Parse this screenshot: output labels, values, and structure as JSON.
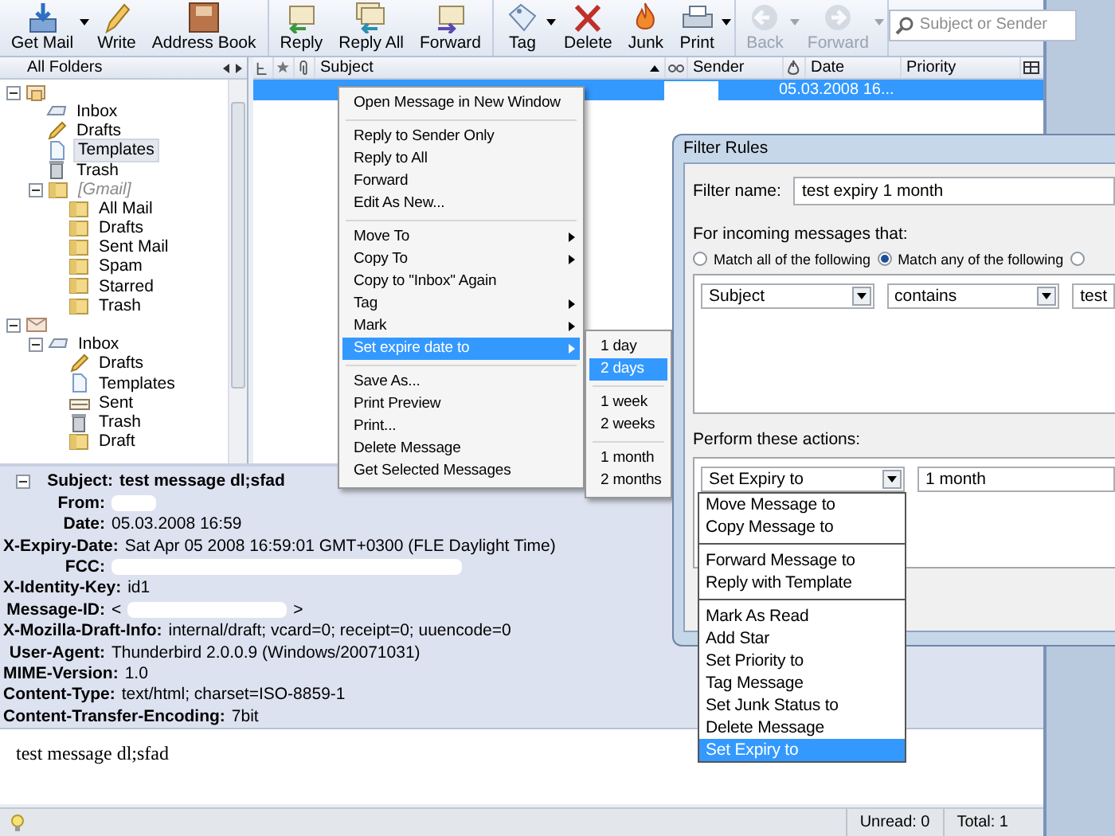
{
  "toolbar": {
    "groups": [
      [
        {
          "kind": "getmail",
          "label": "Get Mail",
          "dropdown": true,
          "disabled": false
        },
        {
          "kind": "write",
          "label": "Write",
          "dropdown": false,
          "disabled": false
        },
        {
          "kind": "addressbook",
          "label": "Address Book",
          "dropdown": false,
          "disabled": false
        }
      ],
      [
        {
          "kind": "reply",
          "label": "Reply",
          "dropdown": false,
          "disabled": false
        },
        {
          "kind": "replyall",
          "label": "Reply All",
          "dropdown": false,
          "disabled": false
        },
        {
          "kind": "forward",
          "label": "Forward",
          "dropdown": false,
          "disabled": false
        }
      ],
      [
        {
          "kind": "tag",
          "label": "Tag",
          "dropdown": true,
          "disabled": false
        },
        {
          "kind": "delete",
          "label": "Delete",
          "dropdown": false,
          "disabled": false
        },
        {
          "kind": "junk",
          "label": "Junk",
          "dropdown": false,
          "disabled": false
        },
        {
          "kind": "print",
          "label": "Print",
          "dropdown": true,
          "disabled": false
        }
      ],
      [
        {
          "kind": "back",
          "label": "Back",
          "dropdown": true,
          "disabled": true
        },
        {
          "kind": "next",
          "label": "Forward",
          "dropdown": true,
          "disabled": true
        }
      ]
    ],
    "search": {
      "placeholder": "Subject or Sender"
    }
  },
  "folder_pane": {
    "title": "All Folders",
    "folders": [
      {
        "kind": "account",
        "expanded": true,
        "children": [
          {
            "kind": "inbox",
            "label": "Inbox",
            "selected": false
          },
          {
            "kind": "drafts",
            "label": "Drafts",
            "selected": false
          },
          {
            "kind": "templates",
            "label": "Templates",
            "selected": true
          },
          {
            "kind": "trash",
            "label": "Trash",
            "selected": false
          },
          {
            "kind": "folder",
            "label": "[Gmail]",
            "virtual": true,
            "selected": false,
            "expanded": true,
            "children": [
              {
                "kind": "folder",
                "label": "All Mail",
                "selected": false
              },
              {
                "kind": "folder",
                "label": "Drafts",
                "selected": false
              },
              {
                "kind": "folder",
                "label": "Sent Mail",
                "selected": false
              },
              {
                "kind": "folder",
                "label": "Spam",
                "selected": false
              },
              {
                "kind": "folder",
                "label": "Starred",
                "selected": false
              },
              {
                "kind": "folder",
                "label": "Trash",
                "selected": false
              }
            ]
          }
        ]
      },
      {
        "kind": "localaccount",
        "expanded": true,
        "children": [
          {
            "kind": "inbox",
            "label": "Inbox",
            "selected": false,
            "expanded": true,
            "children": [
              {
                "kind": "drafts",
                "label": "Drafts",
                "selected": false
              },
              {
                "kind": "templates",
                "label": "Templates",
                "selected": false
              },
              {
                "kind": "sent",
                "label": "Sent",
                "selected": false
              },
              {
                "kind": "trash",
                "label": "Trash",
                "selected": false
              },
              {
                "kind": "folder",
                "label": "Draft",
                "selected": false
              }
            ]
          }
        ]
      }
    ]
  },
  "thread_pane": {
    "columns": [
      {
        "kind": "thread"
      },
      {
        "kind": "star"
      },
      {
        "kind": "attachment"
      },
      {
        "kind": "text",
        "label": "Subject",
        "sorted": true
      },
      {
        "kind": "read"
      },
      {
        "kind": "text",
        "label": "Sender"
      },
      {
        "kind": "junk"
      },
      {
        "kind": "text",
        "label": "Date"
      },
      {
        "kind": "text",
        "label": "Priority"
      },
      {
        "kind": "picker"
      }
    ],
    "rows": [
      {
        "date": "05.03.2008 16...",
        "selected": true
      }
    ]
  },
  "context_menu": {
    "groups": [
      [
        {
          "label": "Open Message in New Window",
          "submenu": false,
          "selected": false
        }
      ],
      [
        {
          "label": "Reply to Sender Only",
          "submenu": false,
          "selected": false
        },
        {
          "label": "Reply to All",
          "submenu": false,
          "selected": false
        },
        {
          "label": "Forward",
          "submenu": false,
          "selected": false
        },
        {
          "label": "Edit As New...",
          "submenu": false,
          "selected": false
        }
      ],
      [
        {
          "label": "Move To",
          "submenu": true,
          "selected": false
        },
        {
          "label": "Copy To",
          "submenu": true,
          "selected": false
        },
        {
          "label": "Copy to \"Inbox\" Again",
          "submenu": false,
          "selected": false
        },
        {
          "label": "Tag",
          "submenu": true,
          "selected": false
        },
        {
          "label": "Mark",
          "submenu": true,
          "selected": false
        },
        {
          "label": "Set expire date to",
          "submenu": true,
          "selected": true
        }
      ],
      [
        {
          "label": "Save As...",
          "submenu": false,
          "selected": false
        },
        {
          "label": "Print Preview",
          "submenu": false,
          "selected": false
        },
        {
          "label": "Print...",
          "submenu": false,
          "selected": false
        },
        {
          "label": "Delete Message",
          "submenu": false,
          "selected": false
        },
        {
          "label": "Get Selected Messages",
          "submenu": false,
          "selected": false
        }
      ]
    ]
  },
  "submenu": {
    "groups": [
      [
        {
          "label": "1 day",
          "selected": false
        },
        {
          "label": "2 days",
          "selected": true
        }
      ],
      [
        {
          "label": "1 week",
          "selected": false
        },
        {
          "label": "2 weeks",
          "selected": false
        }
      ],
      [
        {
          "label": "1 month",
          "selected": false
        },
        {
          "label": "2 months",
          "selected": false
        }
      ]
    ]
  },
  "message_headers": {
    "expanded": true,
    "fields": [
      {
        "label": "Subject:",
        "value": "test message dl;sfad",
        "bold": true
      },
      {
        "label": "From:",
        "redacted": true
      },
      {
        "label": "Date:",
        "value": "05.03.2008 16:59"
      },
      {
        "label": "X-Expiry-Date:",
        "value": "Sat Apr 05 2008 16:59:01 GMT+0300 (FLE Daylight Time)"
      },
      {
        "label": "FCC:",
        "redacted": true
      },
      {
        "label": "X-Identity-Key:",
        "value": "id1"
      },
      {
        "label": "Message-ID:",
        "value": "<",
        "value_after": ">",
        "redacted": true
      },
      {
        "label": "X-Mozilla-Draft-Info:",
        "value": "internal/draft; vcard=0; receipt=0; uuencode=0"
      },
      {
        "label": "User-Agent:",
        "value": "Thunderbird 2.0.0.9 (Windows/20071031)"
      },
      {
        "label": "MIME-Version:",
        "value": "1.0"
      },
      {
        "label": "Content-Type:",
        "value": "text/html; charset=ISO-8859-1"
      },
      {
        "label": "Content-Transfer-Encoding:",
        "value": "7bit"
      }
    ]
  },
  "message_body": "test message dl;sfad",
  "status_bar": {
    "unread": "Unread: 0",
    "total": "Total: 1"
  },
  "filter_dialog": {
    "title": "Filter Rules",
    "name_label": "Filter name:",
    "name_value": "test expiry 1 month",
    "conditions_label": "For incoming messages that:",
    "match_options": [
      {
        "label": "Match all of the following",
        "selected": false
      },
      {
        "label": "Match any of the following",
        "selected": true
      },
      {
        "selected": false
      }
    ],
    "condition": {
      "field": "Subject",
      "operator": "contains",
      "value": "test"
    },
    "actions_label": "Perform these actions:",
    "action": {
      "type": "Set Expiry to",
      "value": "1 month"
    },
    "action_dropdown": {
      "groups": [
        [
          {
            "label": "Move Message to",
            "selected": false
          },
          {
            "label": "Copy Message to",
            "selected": false
          }
        ],
        [
          {
            "label": "Forward Message to",
            "selected": false
          },
          {
            "label": "Reply with Template",
            "selected": false
          }
        ],
        [
          {
            "label": "Mark As Read",
            "selected": false
          },
          {
            "label": "Add Star",
            "selected": false
          },
          {
            "label": "Set Priority to",
            "selected": false
          },
          {
            "label": "Tag Message",
            "selected": false
          },
          {
            "label": "Set Junk Status to",
            "selected": false
          },
          {
            "label": "Delete Message",
            "selected": false
          },
          {
            "label": "Set Expiry to",
            "selected": true
          }
        ]
      ]
    }
  }
}
